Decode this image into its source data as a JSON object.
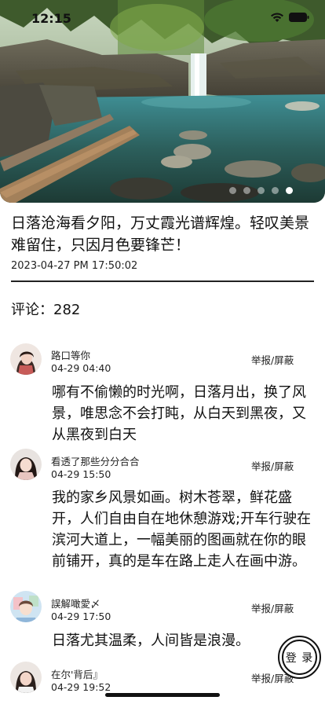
{
  "status_bar": {
    "time": "12:15"
  },
  "article": {
    "title": "日落沧海看夕阳，万丈霞光谱辉煌。轻叹美景难留住，只因月色要锋芒！",
    "time": "2023-04-27 PM 17:50:02",
    "comment_count_label": "评论：282"
  },
  "carousel": {
    "dot_count": 5,
    "active_index": 4
  },
  "comments": [
    {
      "username": "路口等你",
      "time": "04-29 04:40",
      "report": "举报/屏蔽",
      "text": "哪有不偷懒的时光啊，日落月出，换了风景，唯思念不会打盹，从白天到黑夜，又从黑夜到白天"
    },
    {
      "username": "看透了那些分分合合",
      "time": "04-29 15:50",
      "report": "举报/屏蔽",
      "text": "我的家乡风景如画。树木苍翠，鲜花盛开，人们自由自在地休憩游戏;开车行驶在滨河大道上，一幅美丽的图画就在你的眼前铺开，真的是车在路上走人在画中游。"
    },
    {
      "username": "誤解噉愛〆",
      "time": "04-29 17:50",
      "report": "举报/屏蔽",
      "text": "日落尤其温柔，人间皆是浪漫。"
    },
    {
      "username": "在尔'背后』",
      "time": "04-29 19:52",
      "report": "举报/屏蔽",
      "text": ""
    }
  ],
  "login_button": {
    "label": "登 录"
  },
  "icons": {
    "wifi": "wifi-icon",
    "battery": "battery-icon"
  }
}
